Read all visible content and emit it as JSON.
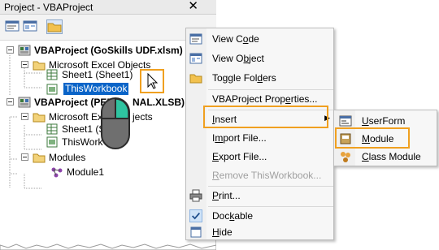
{
  "window": {
    "title": "Project - VBAProject",
    "close_glyph": "✕"
  },
  "toolbar": {
    "buttons": [
      "view-code-icon",
      "view-object-icon",
      "toggle-folders-icon"
    ]
  },
  "tree": {
    "project1": "VBAProject (GoSkills UDF.xlsm)",
    "objects1": "Microsoft Excel Objects",
    "sheet1": "Sheet1 (Sheet1)",
    "workbook1": "ThisWorkbook",
    "project2": "VBAProject (PER",
    "project2_tail": "NAL.XLSB)",
    "objects2": "Microsoft Excel",
    "objects2_tail": "jects",
    "sheet2": "Sheet1 (S",
    "workbook2": "ThisWork",
    "modules": "Modules",
    "module1": "Module1"
  },
  "menu": {
    "items": [
      {
        "pre": "View C",
        "u": "o",
        "post": "de",
        "icon": "view-code-icon"
      },
      {
        "pre": "View O",
        "u": "b",
        "post": "ject",
        "icon": "view-object-icon"
      },
      {
        "pre": "Toggle Fol",
        "u": "d",
        "post": "ers",
        "icon": "folder-icon"
      },
      {
        "pre": "VBAProject Prop",
        "u": "e",
        "post": "rties...",
        "icon": ""
      },
      {
        "pre": "",
        "u": "I",
        "post": "nsert",
        "icon": ""
      },
      {
        "pre": "I",
        "u": "m",
        "post": "port File...",
        "icon": ""
      },
      {
        "pre": "",
        "u": "E",
        "post": "xport File...",
        "icon": ""
      },
      {
        "pre": "",
        "u": "R",
        "post": "emove ThisWorkbook...",
        "icon": ""
      },
      {
        "pre": "",
        "u": "P",
        "post": "rint...",
        "icon": "printer-icon"
      },
      {
        "pre": "Doc",
        "u": "k",
        "post": "able",
        "icon": "checkmark-icon"
      },
      {
        "pre": "",
        "u": "H",
        "post": "ide",
        "icon": "hide-icon"
      }
    ],
    "submenu_arrow": "▶"
  },
  "submenu": {
    "items": [
      {
        "pre": "",
        "u": "U",
        "post": "serForm",
        "icon": "userform-icon"
      },
      {
        "pre": "",
        "u": "M",
        "post": "odule",
        "icon": "module-icon"
      },
      {
        "pre": "",
        "u": "C",
        "post": "lass Module",
        "icon": "class-module-icon"
      }
    ]
  },
  "colors": {
    "highlight": "#f0a020",
    "selection": "#0a64c8",
    "mouse_button": "#2ec4a0"
  }
}
